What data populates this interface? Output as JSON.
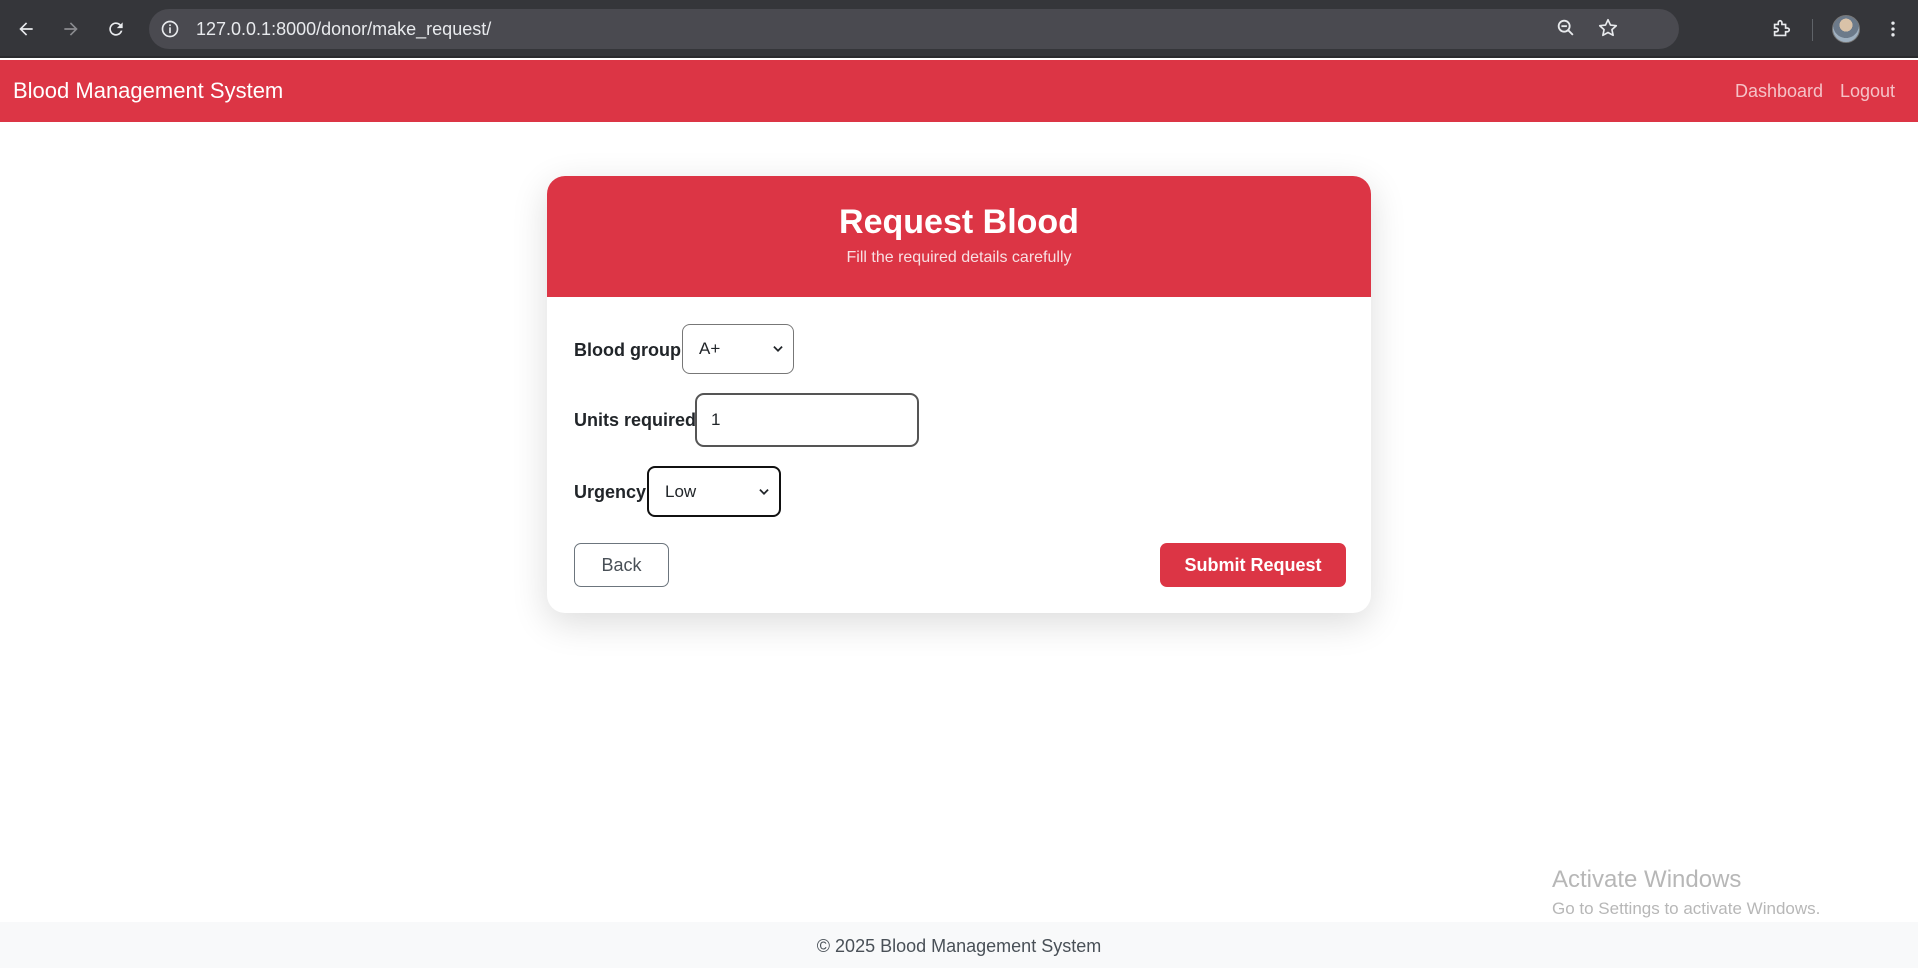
{
  "browser": {
    "url": "127.0.0.1:8000/donor/make_request/"
  },
  "navbar": {
    "brand": "Blood Management System",
    "links": [
      "Dashboard",
      "Logout"
    ]
  },
  "card": {
    "title": "Request Blood",
    "subtitle": "Fill the required details carefully",
    "fields": {
      "blood_group_label": "Blood group",
      "blood_group_value": "A+",
      "units_label": "Units required",
      "units_value": "1",
      "urgency_label": "Urgency",
      "urgency_value": "Low"
    },
    "back_label": "Back",
    "submit_label": "Submit Request"
  },
  "footer": {
    "text": "© 2025 Blood Management System"
  },
  "watermark": {
    "title": "Activate Windows",
    "subtitle": "Go to Settings to activate Windows."
  },
  "colors": {
    "primary": "#dc3545",
    "chrome": "#35363a",
    "footer_bg": "#f8f9fa"
  }
}
